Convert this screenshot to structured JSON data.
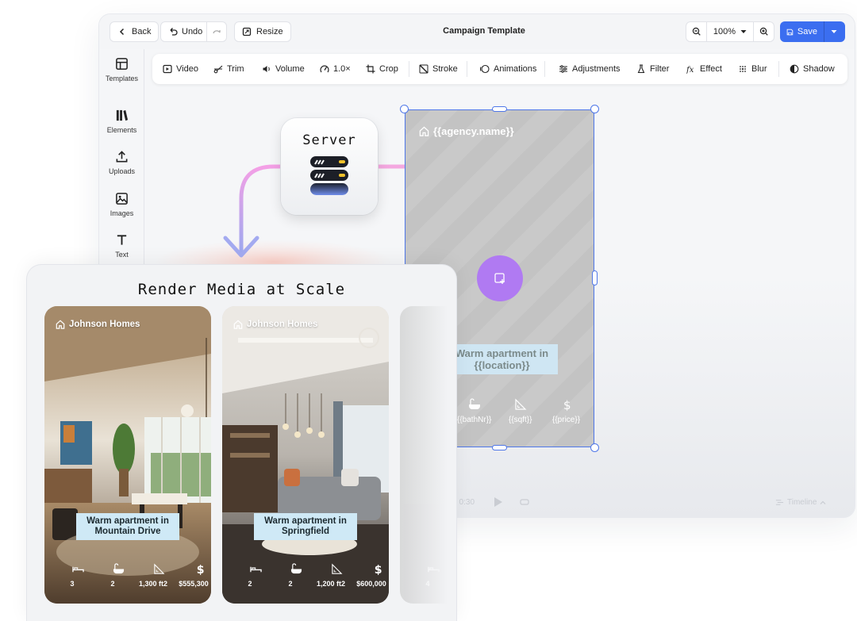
{
  "toolbar_top": {
    "back_label": "Back",
    "undo_label": "Undo",
    "resize_label": "Resize",
    "document_title": "Campaign Template",
    "zoom_level": "100%",
    "save_label": "Save"
  },
  "sidebar": {
    "items": [
      {
        "label": "Templates",
        "icon": "layout-icon"
      },
      {
        "label": "Elements",
        "icon": "elements-icon"
      },
      {
        "label": "Uploads",
        "icon": "upload-icon"
      },
      {
        "label": "Images",
        "icon": "image-icon"
      },
      {
        "label": "Text",
        "icon": "text-icon"
      }
    ]
  },
  "edit_toolbar": {
    "tools": [
      {
        "label": "Video",
        "icon": "video-icon"
      },
      {
        "label": "Trim",
        "icon": "trim-icon"
      },
      {
        "label": "Volume",
        "icon": "volume-icon"
      },
      {
        "label": "1.0×",
        "icon": "speed-icon"
      },
      {
        "label": "Crop",
        "icon": "crop-icon"
      },
      {
        "label": "Stroke",
        "icon": "stroke-icon"
      },
      {
        "label": "Animations",
        "icon": "animations-icon"
      },
      {
        "label": "Adjustments",
        "icon": "adjustments-icon"
      },
      {
        "label": "Filter",
        "icon": "filter-icon"
      },
      {
        "label": "Effect",
        "icon": "effect-icon"
      },
      {
        "label": "Blur",
        "icon": "blur-icon"
      },
      {
        "label": "Shadow",
        "icon": "shadow-icon"
      }
    ]
  },
  "flow": {
    "server_label": "Server"
  },
  "template_card": {
    "agency": "{{agency.name}}",
    "caption": "Warm apartment in {{location}}",
    "stats": [
      "{{bathNr}}",
      "{{sqft}}",
      "{{price}}"
    ]
  },
  "player": {
    "time": "/ 0:30",
    "timeline_label": "Timeline"
  },
  "render_panel": {
    "title": "Render Media at Scale",
    "cards": [
      {
        "agency": "Johnson Homes",
        "caption_line1": "Warm apartment in",
        "caption_line2": "Mountain Drive",
        "stats": [
          "3",
          "2",
          "1,300 ft2",
          "$555,300"
        ]
      },
      {
        "agency": "Johnson Homes",
        "caption_line1": "Warm apartment in",
        "caption_line2": "Springfield",
        "stats": [
          "2",
          "2",
          "1,200 ft2",
          "$600,000"
        ]
      }
    ],
    "partial_card_stat": "4"
  },
  "colors": {
    "accent": "#3b6ef0",
    "selection": "#4f77e8",
    "upload_button": "#b07af2",
    "caption_bg": "#cfe9f6"
  }
}
